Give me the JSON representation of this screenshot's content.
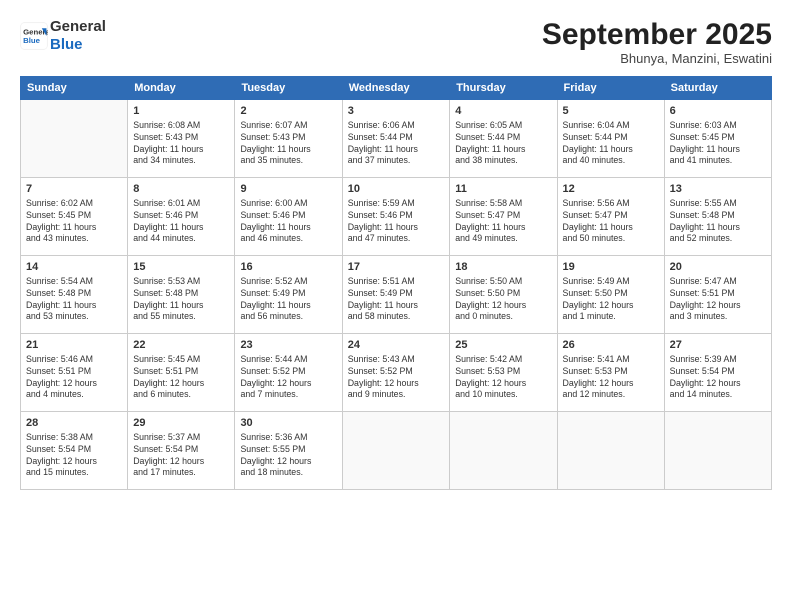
{
  "header": {
    "logo_line1": "General",
    "logo_line2": "Blue",
    "month": "September 2025",
    "location": "Bhunya, Manzini, Eswatini"
  },
  "weekdays": [
    "Sunday",
    "Monday",
    "Tuesday",
    "Wednesday",
    "Thursday",
    "Friday",
    "Saturday"
  ],
  "weeks": [
    [
      {
        "day": "",
        "info": ""
      },
      {
        "day": "1",
        "info": "Sunrise: 6:08 AM\nSunset: 5:43 PM\nDaylight: 11 hours\nand 34 minutes."
      },
      {
        "day": "2",
        "info": "Sunrise: 6:07 AM\nSunset: 5:43 PM\nDaylight: 11 hours\nand 35 minutes."
      },
      {
        "day": "3",
        "info": "Sunrise: 6:06 AM\nSunset: 5:44 PM\nDaylight: 11 hours\nand 37 minutes."
      },
      {
        "day": "4",
        "info": "Sunrise: 6:05 AM\nSunset: 5:44 PM\nDaylight: 11 hours\nand 38 minutes."
      },
      {
        "day": "5",
        "info": "Sunrise: 6:04 AM\nSunset: 5:44 PM\nDaylight: 11 hours\nand 40 minutes."
      },
      {
        "day": "6",
        "info": "Sunrise: 6:03 AM\nSunset: 5:45 PM\nDaylight: 11 hours\nand 41 minutes."
      }
    ],
    [
      {
        "day": "7",
        "info": "Sunrise: 6:02 AM\nSunset: 5:45 PM\nDaylight: 11 hours\nand 43 minutes."
      },
      {
        "day": "8",
        "info": "Sunrise: 6:01 AM\nSunset: 5:46 PM\nDaylight: 11 hours\nand 44 minutes."
      },
      {
        "day": "9",
        "info": "Sunrise: 6:00 AM\nSunset: 5:46 PM\nDaylight: 11 hours\nand 46 minutes."
      },
      {
        "day": "10",
        "info": "Sunrise: 5:59 AM\nSunset: 5:46 PM\nDaylight: 11 hours\nand 47 minutes."
      },
      {
        "day": "11",
        "info": "Sunrise: 5:58 AM\nSunset: 5:47 PM\nDaylight: 11 hours\nand 49 minutes."
      },
      {
        "day": "12",
        "info": "Sunrise: 5:56 AM\nSunset: 5:47 PM\nDaylight: 11 hours\nand 50 minutes."
      },
      {
        "day": "13",
        "info": "Sunrise: 5:55 AM\nSunset: 5:48 PM\nDaylight: 11 hours\nand 52 minutes."
      }
    ],
    [
      {
        "day": "14",
        "info": "Sunrise: 5:54 AM\nSunset: 5:48 PM\nDaylight: 11 hours\nand 53 minutes."
      },
      {
        "day": "15",
        "info": "Sunrise: 5:53 AM\nSunset: 5:48 PM\nDaylight: 11 hours\nand 55 minutes."
      },
      {
        "day": "16",
        "info": "Sunrise: 5:52 AM\nSunset: 5:49 PM\nDaylight: 11 hours\nand 56 minutes."
      },
      {
        "day": "17",
        "info": "Sunrise: 5:51 AM\nSunset: 5:49 PM\nDaylight: 11 hours\nand 58 minutes."
      },
      {
        "day": "18",
        "info": "Sunrise: 5:50 AM\nSunset: 5:50 PM\nDaylight: 12 hours\nand 0 minutes."
      },
      {
        "day": "19",
        "info": "Sunrise: 5:49 AM\nSunset: 5:50 PM\nDaylight: 12 hours\nand 1 minute."
      },
      {
        "day": "20",
        "info": "Sunrise: 5:47 AM\nSunset: 5:51 PM\nDaylight: 12 hours\nand 3 minutes."
      }
    ],
    [
      {
        "day": "21",
        "info": "Sunrise: 5:46 AM\nSunset: 5:51 PM\nDaylight: 12 hours\nand 4 minutes."
      },
      {
        "day": "22",
        "info": "Sunrise: 5:45 AM\nSunset: 5:51 PM\nDaylight: 12 hours\nand 6 minutes."
      },
      {
        "day": "23",
        "info": "Sunrise: 5:44 AM\nSunset: 5:52 PM\nDaylight: 12 hours\nand 7 minutes."
      },
      {
        "day": "24",
        "info": "Sunrise: 5:43 AM\nSunset: 5:52 PM\nDaylight: 12 hours\nand 9 minutes."
      },
      {
        "day": "25",
        "info": "Sunrise: 5:42 AM\nSunset: 5:53 PM\nDaylight: 12 hours\nand 10 minutes."
      },
      {
        "day": "26",
        "info": "Sunrise: 5:41 AM\nSunset: 5:53 PM\nDaylight: 12 hours\nand 12 minutes."
      },
      {
        "day": "27",
        "info": "Sunrise: 5:39 AM\nSunset: 5:54 PM\nDaylight: 12 hours\nand 14 minutes."
      }
    ],
    [
      {
        "day": "28",
        "info": "Sunrise: 5:38 AM\nSunset: 5:54 PM\nDaylight: 12 hours\nand 15 minutes."
      },
      {
        "day": "29",
        "info": "Sunrise: 5:37 AM\nSunset: 5:54 PM\nDaylight: 12 hours\nand 17 minutes."
      },
      {
        "day": "30",
        "info": "Sunrise: 5:36 AM\nSunset: 5:55 PM\nDaylight: 12 hours\nand 18 minutes."
      },
      {
        "day": "",
        "info": ""
      },
      {
        "day": "",
        "info": ""
      },
      {
        "day": "",
        "info": ""
      },
      {
        "day": "",
        "info": ""
      }
    ]
  ]
}
